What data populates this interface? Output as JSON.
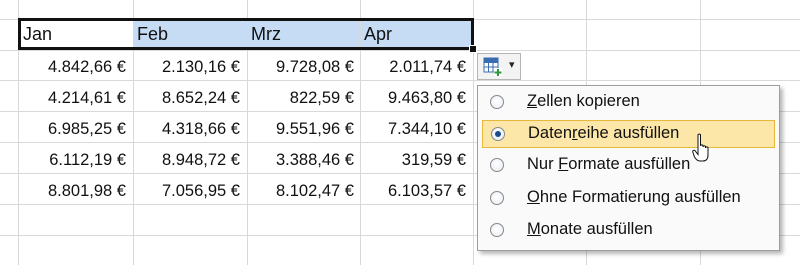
{
  "columns": [
    "Jan",
    "Feb",
    "Mrz",
    "Apr"
  ],
  "rows": [
    [
      "4.842,66 €",
      "2.130,16 €",
      "9.728,08 €",
      "2.011,74 €"
    ],
    [
      "4.214,61 €",
      "8.652,24 €",
      "822,59 €",
      "9.463,80 €"
    ],
    [
      "6.985,25 €",
      "4.318,66 €",
      "9.551,96 €",
      "7.344,10 €"
    ],
    [
      "6.112,19 €",
      "8.948,72 €",
      "3.388,46 €",
      "319,59 €"
    ],
    [
      "8.801,98 €",
      "7.056,95 €",
      "8.102,47 €",
      "6.103,57 €"
    ]
  ],
  "autofill_button": {
    "icon": "autofill-options-icon",
    "caret": "▾"
  },
  "menu": {
    "selected_index": 1,
    "items": [
      {
        "before": "",
        "key": "Z",
        "after": "ellen kopieren"
      },
      {
        "before": "Daten",
        "key": "r",
        "after": "eihe ausfüllen"
      },
      {
        "before": "Nur ",
        "key": "F",
        "after": "ormate ausfüllen"
      },
      {
        "before": "",
        "key": "O",
        "after": "hne Formatierung ausfüllen"
      },
      {
        "before": "",
        "key": "M",
        "after": "onate ausfüllen"
      }
    ]
  },
  "colors": {
    "header_fill": "#c6dcf5",
    "menu_highlight": "#fce6a8",
    "menu_highlight_border": "#e6b93c",
    "radio_dot": "#1d4b89"
  }
}
